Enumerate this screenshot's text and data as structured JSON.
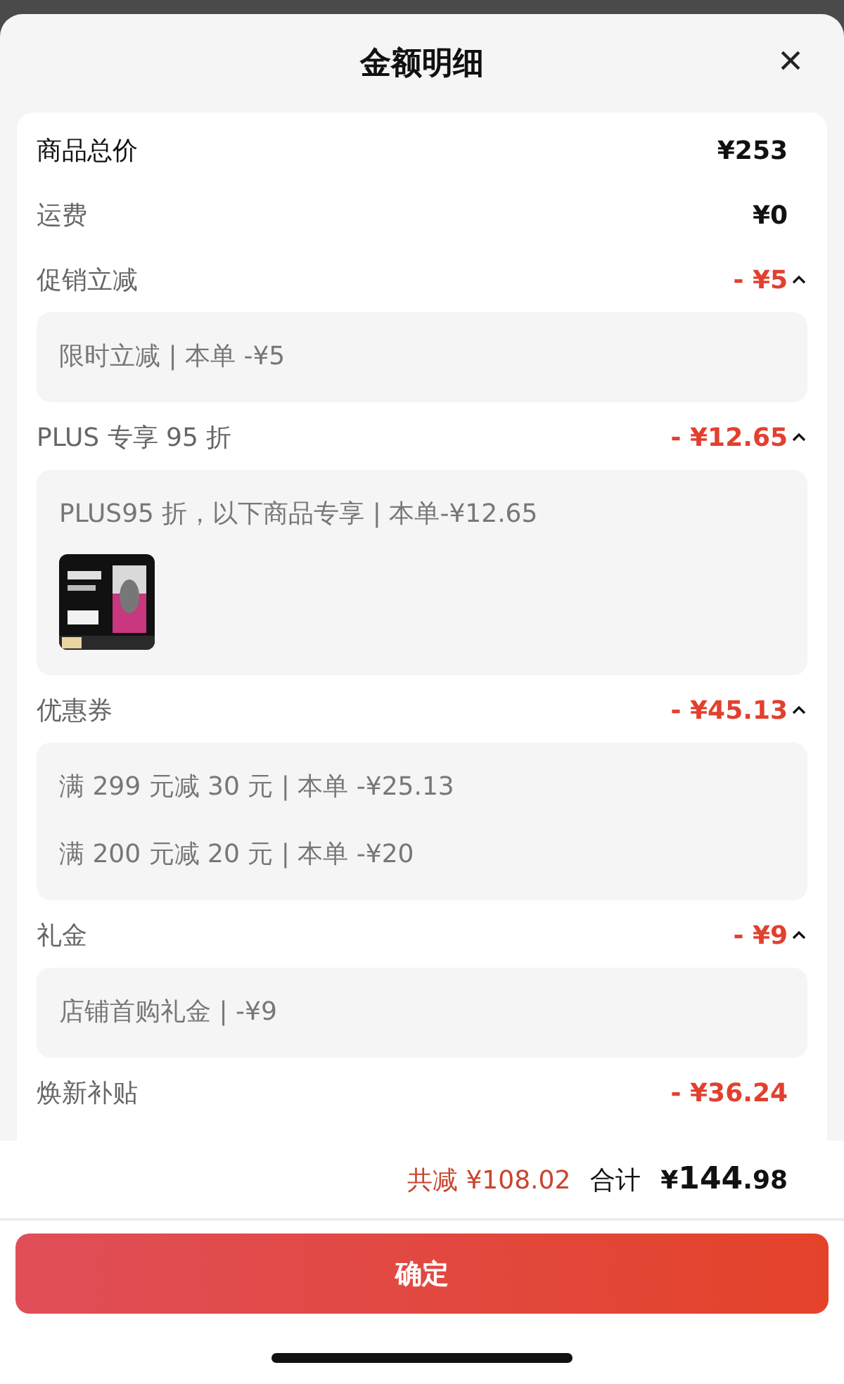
{
  "sheet": {
    "title": "金额明细",
    "close": "×"
  },
  "rows": [
    {
      "kind": "total",
      "label": "商品总价",
      "value": "¥253"
    },
    {
      "kind": "fee",
      "label": "运费",
      "value": "¥0"
    },
    {
      "kind": "discount",
      "label": "促销立减",
      "value": "- ¥5",
      "expanded": true,
      "details": [
        {
          "text": "限时立减 | 本单 -¥5"
        }
      ]
    },
    {
      "kind": "discount",
      "label": "PLUS 专享 95 折",
      "value": "- ¥12.65",
      "expanded": true,
      "details": [
        {
          "text": "PLUS95 折，以下商品专享 | 本单-¥12.65",
          "picture": true
        }
      ]
    },
    {
      "kind": "discount",
      "label": "优惠券",
      "value": "- ¥45.13",
      "expanded": true,
      "details": [
        {
          "text": "满 299 元减 30 元 | 本单 -¥25.13"
        },
        {
          "text": "满 200 元减 20 元 | 本单 -¥20"
        }
      ]
    },
    {
      "kind": "discount",
      "label": "礼金",
      "value": "- ¥9",
      "expanded": true,
      "details": [
        {
          "text": "店铺首购礼金 | -¥9"
        }
      ]
    },
    {
      "kind": "discount_fixed",
      "label": "焕新补贴",
      "value": "- ¥36.24"
    }
  ],
  "summary": {
    "reduced": "共减 ¥108.02",
    "total_label": "合计",
    "total_currency": "¥",
    "total_integer": "144",
    "total_decimal": ".98"
  },
  "confirm_button": "确定"
}
